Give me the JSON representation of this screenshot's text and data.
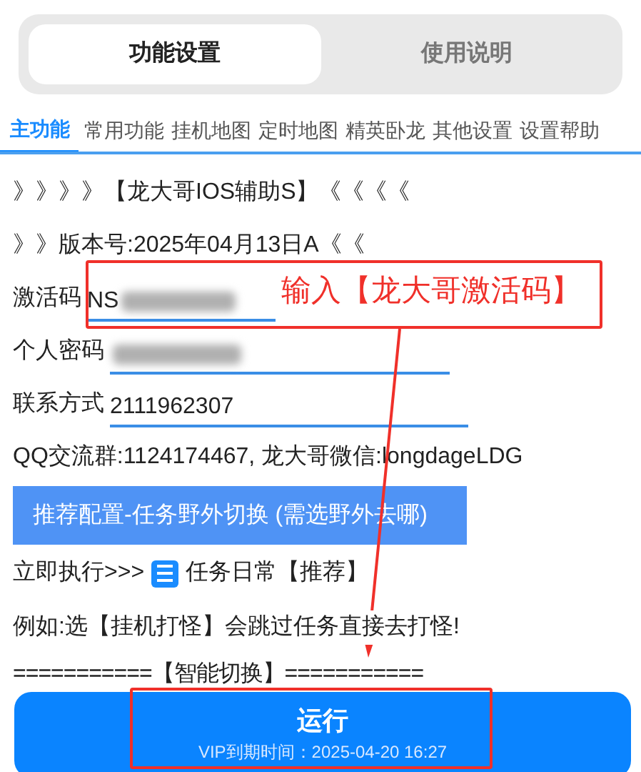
{
  "segments": [
    {
      "label": "功能设置",
      "selected": true
    },
    {
      "label": "使用说明",
      "selected": false
    }
  ],
  "tabs": [
    {
      "label": "主功能",
      "selected": true
    },
    {
      "label": "常用功能",
      "selected": false
    },
    {
      "label": "挂机地图",
      "selected": false
    },
    {
      "label": "定时地图",
      "selected": false
    },
    {
      "label": "精英卧龙",
      "selected": false
    },
    {
      "label": "其他设置",
      "selected": false
    },
    {
      "label": "设置帮助",
      "selected": false
    }
  ],
  "header_lines": [
    "》》》》【龙大哥IOS辅助S】《《《《",
    "》》版本号:2025年04月13日A《《"
  ],
  "fields": [
    {
      "label": "激活码",
      "value": "NS",
      "redacted": true
    },
    {
      "label": "个人密码",
      "redacted": true
    },
    {
      "label": "联系方式",
      "value": "2111962307"
    }
  ],
  "group_info": "QQ交流群:1124174467, 龙大哥微信:longdageLDG",
  "preset_button": "推荐配置-任务野外切换 (需选野外去哪)",
  "execute": {
    "label": "立即执行>>>",
    "option": "任务日常【推荐】"
  },
  "note": "例如:选【挂机打怪】会跳过任务直接去打怪!",
  "divider_text": "===========【智能切换】===========",
  "run_button": {
    "label": "运行",
    "subtitle": "VIP到期时间：2025-04-20 16:27"
  },
  "annotations": [
    {
      "kind": "callout",
      "text": "输入【龙大哥激活码】"
    },
    {
      "kind": "arrow"
    },
    {
      "kind": "box"
    }
  ]
}
